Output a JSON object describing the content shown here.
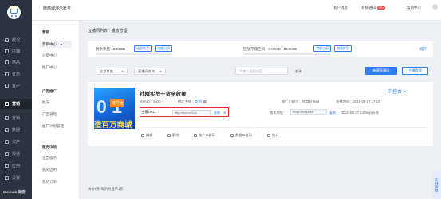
{
  "topbar": {
    "shop_name": "微商城演示账号",
    "service_market": "客户消息",
    "system_notice": "系统通知",
    "notice_count": "99+",
    "help_center": "帮助中心"
  },
  "nav1": [
    {
      "label": "概况"
    },
    {
      "label": "店铺"
    },
    {
      "label": "商品"
    },
    {
      "label": "订单"
    },
    {
      "label": "客户"
    },
    {
      "label": "营销"
    },
    {
      "label": "分销"
    },
    {
      "label": "数据"
    },
    {
      "label": "资产"
    },
    {
      "label": "渠道"
    },
    {
      "label": "应用"
    },
    {
      "label": "设置"
    }
  ],
  "brand": "Weimob 微盟",
  "nav2": {
    "group1": "营销",
    "item_selected": "营销中心",
    "item2": "分销中心",
    "item3": "推广中心",
    "group2": "广告推广",
    "item4": "概况",
    "item5": "广告管理",
    "item6": "推广计划管理",
    "group3": "服务市场",
    "item7": "全部服务",
    "item8": "我的应用",
    "item9": "我的订单"
  },
  "breadcrumb": "直播间列表 · 播放管理",
  "storage": {
    "flow_label": "剩余流量 10.00GB",
    "btn_buy": "流量购买",
    "btn_record": "流量记录",
    "space_label": "回放存储空间：0.00GB / 10.00GB",
    "btn_record2": "流量记录",
    "btn_expand": "流量扩容",
    "expand_link": "展开"
  },
  "filters": {
    "status": "全部状态",
    "name_type": "直播间名称",
    "search_placeholder": "请输入搜索内容",
    "search_btn": "查询",
    "new_btn": "新建直播间",
    "anchor_btn": "主播管理"
  },
  "live": {
    "cover_tag": "待开始",
    "cover_digits": "0 1",
    "cover_bottom": "造百万商城",
    "title": "社群实战干货全收录",
    "room_id_label": "房间ID",
    "room_id": "5920",
    "anchor_label": "绑定主播：",
    "anchor_name": "影响",
    "channel_label": "推广小程序：智慧好商城",
    "time_label": "直播时间：",
    "time_value": "2019-09-27 17:10",
    "status": "中控台 >",
    "url_label": "主播URL：",
    "url_value": "http://tud.cn/Lur",
    "copy1": "复制",
    "push_label": "推流地址：",
    "push_value": "rtmp://livepush",
    "copy2": "复制",
    "push_time": "2019-09-27 14:56前有效",
    "actions": [
      "编辑",
      "删除",
      "推广二维码",
      "数据二维码",
      "统计"
    ]
  },
  "footer": "共计1条 每页为显示1页",
  "chat": "在线客服",
  "colors": {
    "primary": "#2e7cf6",
    "sidebar": "#2b3340",
    "highlight_border": "#e0312b",
    "badge": "#f5413d"
  }
}
